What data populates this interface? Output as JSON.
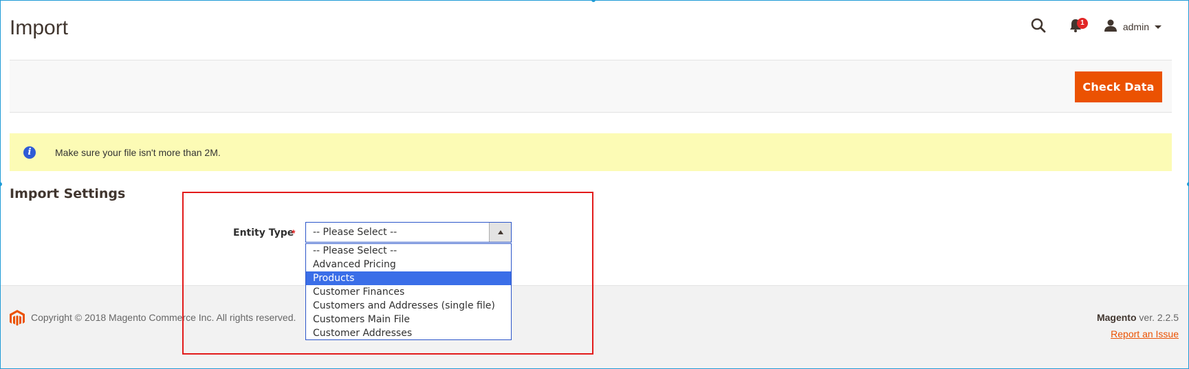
{
  "header": {
    "title": "Import",
    "notification_count": "1",
    "user_name": "admin",
    "icons": [
      "search-icon",
      "bell-icon",
      "user-icon",
      "chevron-down-icon"
    ]
  },
  "toolbar": {
    "check_data_label": "Check Data"
  },
  "notice": {
    "icon": "info-icon",
    "text": "Make sure your file isn't more than 2M."
  },
  "section": {
    "title": "Import Settings"
  },
  "entity_type": {
    "label": "Entity Type",
    "required_mark": "*",
    "selected_value": "-- Please Select --",
    "options": [
      "-- Please Select --",
      "Advanced Pricing",
      "Products",
      "Customer Finances",
      "Customers and Addresses (single file)",
      "Customers Main File",
      "Customer Addresses"
    ],
    "highlighted_option": "Products"
  },
  "footer": {
    "copyright": "Copyright © 2018 Magento Commerce Inc. All rights reserved.",
    "product_name": "Magento",
    "version": "ver. 2.2.5",
    "report_link": "Report an Issue"
  },
  "colors": {
    "accent": "#eb5202",
    "notice_bg": "#fcfbb5",
    "highlight_option": "#3a6ee8",
    "annotation_border": "#e21a1a",
    "badge": "#e22626"
  }
}
